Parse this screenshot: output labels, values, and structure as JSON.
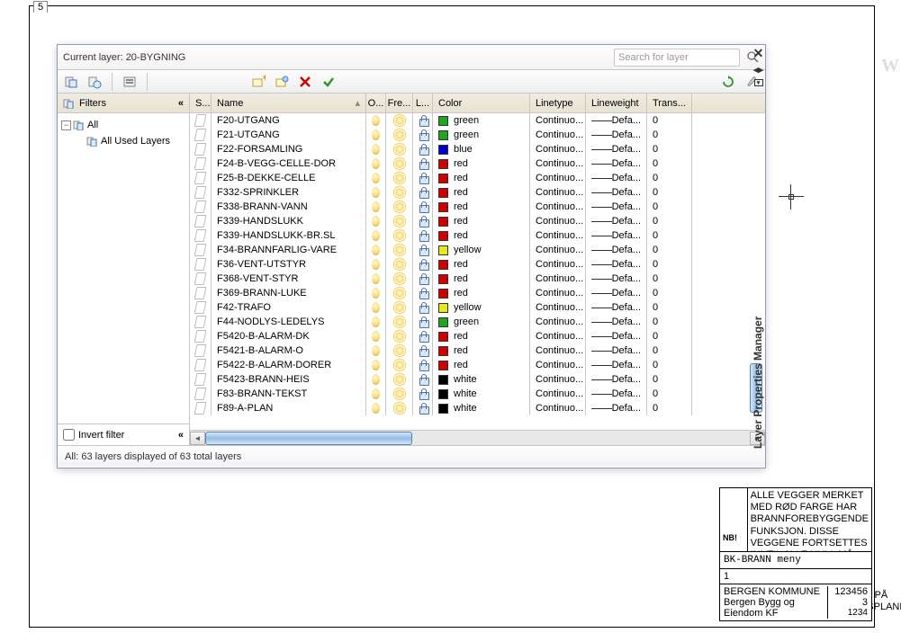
{
  "dialog": {
    "current_layer_label": "Current layer: 20-BYGNING",
    "search_placeholder": "Search for layer",
    "status_text": "All: 63 layers displayed of 63 total layers"
  },
  "filters": {
    "header": "Filters",
    "tree": {
      "root": "All",
      "child": "All Used Layers"
    },
    "invert_label": "Invert filter"
  },
  "columns": {
    "status": "S...",
    "name": "Name",
    "on": "O...",
    "freeze": "Fre...",
    "lock": "L...",
    "color": "Color",
    "linetype": "Linetype",
    "lineweight": "Lineweight",
    "trans": "Trans..."
  },
  "layers": [
    {
      "name": "F20-UTGANG",
      "swatch": "#1eaa1e",
      "color": "green",
      "linetype": "Continuo...",
      "lineweight": "Defa...",
      "trans": "0"
    },
    {
      "name": "F21-UTGANG",
      "swatch": "#1eaa1e",
      "color": "green",
      "linetype": "Continuo...",
      "lineweight": "Defa...",
      "trans": "0"
    },
    {
      "name": "F22-FORSAMLING",
      "swatch": "#0000cc",
      "color": "blue",
      "linetype": "Continuo...",
      "lineweight": "Defa...",
      "trans": "0"
    },
    {
      "name": "F24-B-VEGG-CELLE-DOR",
      "swatch": "#d00000",
      "color": "red",
      "linetype": "Continuo...",
      "lineweight": "Defa...",
      "trans": "0"
    },
    {
      "name": "F25-B-DEKKE-CELLE",
      "swatch": "#d00000",
      "color": "red",
      "linetype": "Continuo...",
      "lineweight": "Defa...",
      "trans": "0"
    },
    {
      "name": "F332-SPRINKLER",
      "swatch": "#d00000",
      "color": "red",
      "linetype": "Continuo...",
      "lineweight": "Defa...",
      "trans": "0"
    },
    {
      "name": "F338-BRANN-VANN",
      "swatch": "#d00000",
      "color": "red",
      "linetype": "Continuo...",
      "lineweight": "Defa...",
      "trans": "0"
    },
    {
      "name": "F339-HANDSLUKK",
      "swatch": "#d00000",
      "color": "red",
      "linetype": "Continuo...",
      "lineweight": "Defa...",
      "trans": "0"
    },
    {
      "name": "F339-HANDSLUKK-BR.SL",
      "swatch": "#d00000",
      "color": "red",
      "linetype": "Continuo...",
      "lineweight": "Defa...",
      "trans": "0"
    },
    {
      "name": "F34-BRANNFARLIG-VARE",
      "swatch": "#e8e820",
      "color": "yellow",
      "linetype": "Continuo...",
      "lineweight": "Defa...",
      "trans": "0"
    },
    {
      "name": "F36-VENT-UTSTYR",
      "swatch": "#d00000",
      "color": "red",
      "linetype": "Continuo...",
      "lineweight": "Defa...",
      "trans": "0"
    },
    {
      "name": "F368-VENT-STYR",
      "swatch": "#d00000",
      "color": "red",
      "linetype": "Continuo...",
      "lineweight": "Defa...",
      "trans": "0"
    },
    {
      "name": "F369-BRANN-LUKE",
      "swatch": "#d00000",
      "color": "red",
      "linetype": "Continuo...",
      "lineweight": "Defa...",
      "trans": "0"
    },
    {
      "name": "F42-TRAFO",
      "swatch": "#e8e820",
      "color": "yellow",
      "linetype": "Continuo...",
      "lineweight": "Defa...",
      "trans": "0"
    },
    {
      "name": "F44-NODLYS-LEDELYS",
      "swatch": "#1eaa1e",
      "color": "green",
      "linetype": "Continuo...",
      "lineweight": "Defa...",
      "trans": "0"
    },
    {
      "name": "F5420-B-ALARM-DK",
      "swatch": "#d00000",
      "color": "red",
      "linetype": "Continuo...",
      "lineweight": "Defa...",
      "trans": "0"
    },
    {
      "name": "F5421-B-ALARM-O",
      "swatch": "#d00000",
      "color": "red",
      "linetype": "Continuo...",
      "lineweight": "Defa...",
      "trans": "0"
    },
    {
      "name": "F5422-B-ALARM-DORER",
      "swatch": "#d00000",
      "color": "red",
      "linetype": "Continuo...",
      "lineweight": "Defa...",
      "trans": "0"
    },
    {
      "name": "F5423-BRANN-HEIS",
      "swatch": "#000000",
      "color": "white",
      "linetype": "Continuo...",
      "lineweight": "Defa...",
      "trans": "0"
    },
    {
      "name": "F83-BRANN-TEKST",
      "swatch": "#000000",
      "color": "white",
      "linetype": "Continuo...",
      "lineweight": "Defa...",
      "trans": "0"
    },
    {
      "name": "F89-A-PLAN",
      "swatch": "#000000",
      "color": "white",
      "linetype": "Continuo...",
      "lineweight": "Defa...",
      "trans": "0"
    }
  ],
  "side_title": "Layer Properties Manager",
  "titleblock": {
    "main": "BK-BRANN meny",
    "num": "1",
    "code": "123456",
    "ed": "3",
    "id": "1234",
    "line1": "BERGEN KOMMUNE",
    "line2": "Bergen Bygg og Eiendom KF"
  },
  "nb": {
    "label": "NB!",
    "r1": "ALLE VEGGER MERKET MED RØD FARGE\nHAR BRANNFOREBYGGENDE FUNKSJON.\nDISSE VEGGENE FORTSETTES INNTIL\nALLE HULL MÅ TETTES FORSKRIFTSMESSIG",
    "r2": "ALLE ENDRINGER RETTES\nPÅ BRANNDOKUMENTASJONSPLANEN."
  }
}
